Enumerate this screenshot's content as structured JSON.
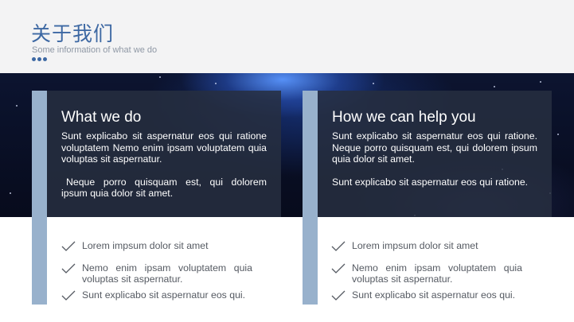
{
  "header": {
    "title": "关于我们",
    "subtitle": "Some information of what we do"
  },
  "colors": {
    "accent": "#3d68a3",
    "bar": "#98b1cc",
    "panel": "#262e40",
    "header_bg": "#f3f3f4",
    "list_text": "#555a62"
  },
  "cards": [
    {
      "heading": "What we do",
      "paragraphs": [
        "Sunt explicabo sit aspernatur eos qui ratione voluptatem Nemo enim ipsam voluptatem quia voluptas sit aspernatur.",
        "Neque porro quisquam est, qui dolorem ipsum quia dolor sit amet."
      ],
      "items": [
        "Lorem impsum dolor sit amet",
        "Nemo enim ipsam voluptatem quia voluptas sit aspernatur.",
        "Sunt explicabo sit aspernatur eos qui."
      ]
    },
    {
      "heading": "How we can help you",
      "paragraphs": [
        "Sunt explicabo sit aspernatur eos qui ratione. Neque porro quisquam est, qui dolorem ipsum quia dolor sit amet.",
        "Sunt explicabo sit aspernatur eos qui ratione."
      ],
      "items": [
        "Lorem impsum dolor sit amet",
        "Nemo enim ipsam voluptatem quia voluptas sit aspernatur.",
        "Sunt explicabo sit aspernatur eos qui."
      ]
    }
  ],
  "icons": {
    "check": "check-icon",
    "dots": "dots-icon"
  }
}
